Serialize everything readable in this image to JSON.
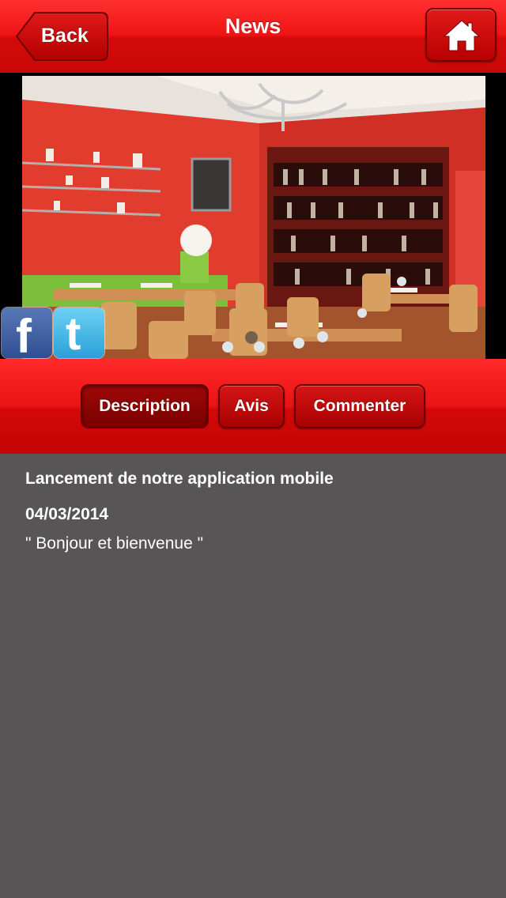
{
  "header": {
    "title": "News",
    "back_label": "Back",
    "home_icon": "home-icon"
  },
  "photo": {
    "social": [
      "facebook-icon",
      "twitter-icon"
    ],
    "fb_glyph": "f",
    "tw_glyph": "t"
  },
  "tabs": [
    {
      "label": "Description",
      "active": true
    },
    {
      "label": "Avis",
      "active": false
    },
    {
      "label": "Commenter",
      "active": false
    }
  ],
  "article": {
    "title": "Lancement de notre application mobile",
    "date": "04/03/2014",
    "body": "\" Bonjour et bienvenue \""
  },
  "colors": {
    "header_red": "#e81414",
    "content_bg": "#575556",
    "active_tab": "#8a0404"
  }
}
